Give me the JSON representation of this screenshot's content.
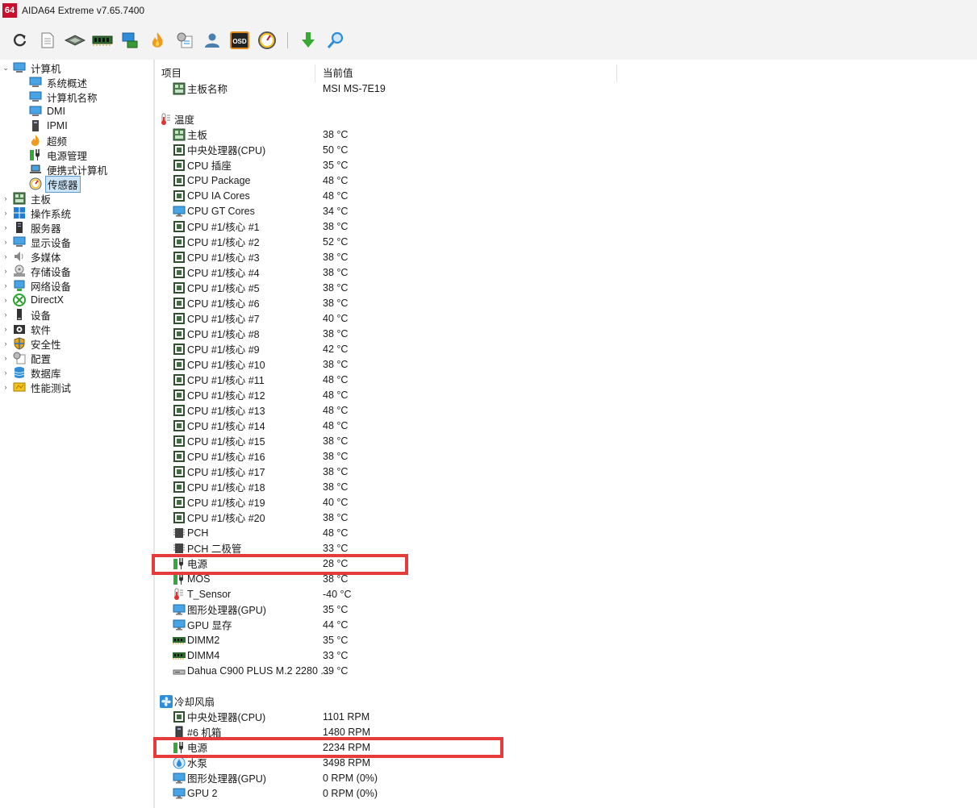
{
  "window": {
    "logo": "64",
    "title": "AIDA64 Extreme v7.65.7400"
  },
  "toolbar": {
    "buttons": [
      "refresh-icon",
      "report-icon",
      "motherboard-icon",
      "memory-icon",
      "network-icon",
      "flame-icon",
      "config-icon",
      "user-icon",
      "osd-icon",
      "gauge-icon",
      "download-icon",
      "search-icon"
    ],
    "osd_text": "OSD"
  },
  "tree": {
    "computer": {
      "label": "计算机",
      "children": [
        "系统概述",
        "计算机名称",
        "DMI",
        "IPMI",
        "超频",
        "电源管理",
        "便携式计算机",
        "传感器"
      ]
    },
    "top": [
      "主板",
      "操作系统",
      "服务器",
      "显示设备",
      "多媒体",
      "存储设备",
      "网络设备",
      "DirectX",
      "设备",
      "软件",
      "安全性",
      "配置",
      "数据库",
      "性能测试"
    ]
  },
  "list": {
    "header": {
      "col1": "项目",
      "col2": "当前值"
    },
    "board": {
      "name": "主板名称",
      "value": "MSI MS-7E19"
    },
    "temp_title": "温度",
    "temps": [
      {
        "name": "主板",
        "value": "38 °C",
        "icon": "board"
      },
      {
        "name": "中央处理器(CPU)",
        "value": "50 °C",
        "icon": "chip"
      },
      {
        "name": "CPU 插座",
        "value": "35 °C",
        "icon": "chip"
      },
      {
        "name": "CPU Package",
        "value": "48 °C",
        "icon": "chip"
      },
      {
        "name": "CPU IA Cores",
        "value": "48 °C",
        "icon": "chip"
      },
      {
        "name": "CPU GT Cores",
        "value": "34 °C",
        "icon": "monitor"
      },
      {
        "name": "CPU #1/核心 #1",
        "value": "38 °C",
        "icon": "chip"
      },
      {
        "name": "CPU #1/核心 #2",
        "value": "52 °C",
        "icon": "chip"
      },
      {
        "name": "CPU #1/核心 #3",
        "value": "38 °C",
        "icon": "chip"
      },
      {
        "name": "CPU #1/核心 #4",
        "value": "38 °C",
        "icon": "chip"
      },
      {
        "name": "CPU #1/核心 #5",
        "value": "38 °C",
        "icon": "chip"
      },
      {
        "name": "CPU #1/核心 #6",
        "value": "38 °C",
        "icon": "chip"
      },
      {
        "name": "CPU #1/核心 #7",
        "value": "40 °C",
        "icon": "chip"
      },
      {
        "name": "CPU #1/核心 #8",
        "value": "38 °C",
        "icon": "chip"
      },
      {
        "name": "CPU #1/核心 #9",
        "value": "42 °C",
        "icon": "chip"
      },
      {
        "name": "CPU #1/核心 #10",
        "value": "38 °C",
        "icon": "chip"
      },
      {
        "name": "CPU #1/核心 #11",
        "value": "48 °C",
        "icon": "chip"
      },
      {
        "name": "CPU #1/核心 #12",
        "value": "48 °C",
        "icon": "chip"
      },
      {
        "name": "CPU #1/核心 #13",
        "value": "48 °C",
        "icon": "chip"
      },
      {
        "name": "CPU #1/核心 #14",
        "value": "48 °C",
        "icon": "chip"
      },
      {
        "name": "CPU #1/核心 #15",
        "value": "38 °C",
        "icon": "chip"
      },
      {
        "name": "CPU #1/核心 #16",
        "value": "38 °C",
        "icon": "chip"
      },
      {
        "name": "CPU #1/核心 #17",
        "value": "38 °C",
        "icon": "chip"
      },
      {
        "name": "CPU #1/核心 #18",
        "value": "38 °C",
        "icon": "chip"
      },
      {
        "name": "CPU #1/核心 #19",
        "value": "40 °C",
        "icon": "chip"
      },
      {
        "name": "CPU #1/核心 #20",
        "value": "38 °C",
        "icon": "chip"
      },
      {
        "name": "PCH",
        "value": "48 °C",
        "icon": "pch"
      },
      {
        "name": "PCH 二极管",
        "value": "33 °C",
        "icon": "pch"
      },
      {
        "name": "电源",
        "value": "28 °C",
        "icon": "power"
      },
      {
        "name": "MOS",
        "value": "38 °C",
        "icon": "power"
      },
      {
        "name": "T_Sensor",
        "value": "-40 °C",
        "icon": "thermo"
      },
      {
        "name": "图形处理器(GPU)",
        "value": "35 °C",
        "icon": "monitor"
      },
      {
        "name": "GPU 显存",
        "value": "44 °C",
        "icon": "monitor"
      },
      {
        "name": "DIMM2",
        "value": "35 °C",
        "icon": "ram"
      },
      {
        "name": "DIMM4",
        "value": "33 °C",
        "icon": "ram"
      },
      {
        "name": "Dahua C900 PLUS M.2 2280 ...",
        "value": "39 °C",
        "icon": "disk"
      }
    ],
    "fan_title": "冷却风扇",
    "fans": [
      {
        "name": "中央处理器(CPU)",
        "value": "1101 RPM",
        "icon": "chip"
      },
      {
        "name": "#6 机箱",
        "value": "1480 RPM",
        "icon": "case"
      },
      {
        "name": "电源",
        "value": "2234 RPM",
        "icon": "power"
      },
      {
        "name": "水泵",
        "value": "3498 RPM",
        "icon": "water"
      },
      {
        "name": "图形处理器(GPU)",
        "value": "0 RPM  (0%)",
        "icon": "monitor"
      },
      {
        "name": "GPU 2",
        "value": "0 RPM  (0%)",
        "icon": "monitor"
      }
    ]
  },
  "colors": {
    "highlight": "#e63b3b",
    "selected_bg": "#cce4f7"
  }
}
